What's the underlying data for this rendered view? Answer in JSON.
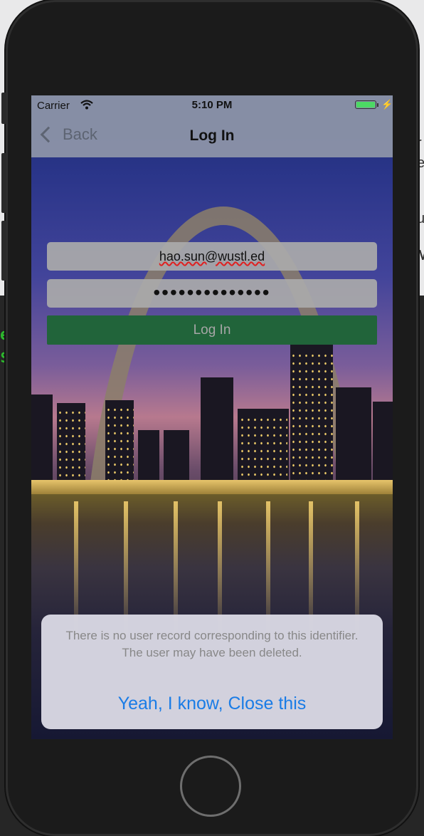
{
  "desktop": {
    "left_fragments": [
      "e",
      "$"
    ],
    "right_fragments": [
      "r",
      "e",
      "u",
      "M"
    ]
  },
  "status_bar": {
    "carrier": "Carrier",
    "time": "5:10 PM"
  },
  "nav": {
    "back_label": "Back",
    "title": "Log In"
  },
  "form": {
    "email_value": "hao.sun@wustl.ed",
    "password_value": "••••••••••••••",
    "login_button": "Log In"
  },
  "alert": {
    "message": "There is no user record corresponding to this identifier. The user may have been deleted.",
    "button": "Yeah, I know, Close this"
  },
  "colors": {
    "login_button_bg": "#21643a",
    "alert_button_text": "#1a7ce6",
    "battery_fill": "#4cd964"
  }
}
